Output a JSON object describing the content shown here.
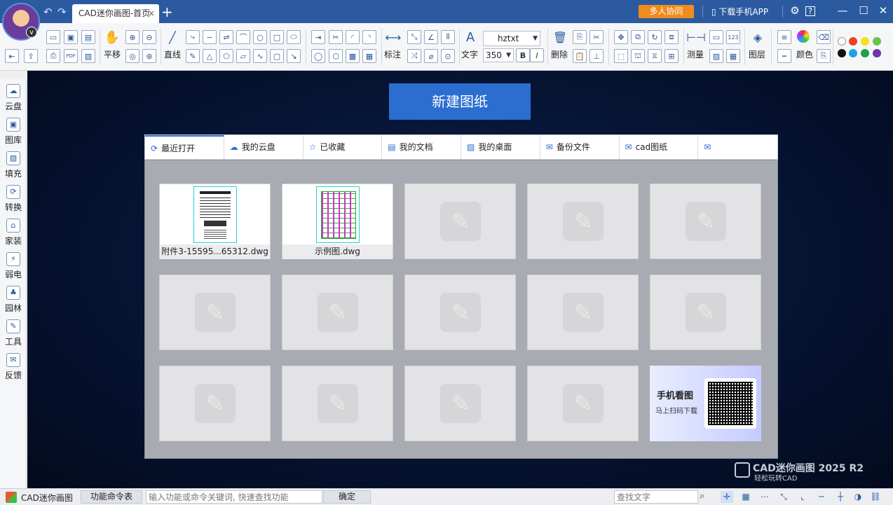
{
  "app": {
    "tab_title": "CAD迷你画图-首页",
    "tab_close": "×",
    "tab_add": "+",
    "collab": "多人协同",
    "download_app": "下载手机APP",
    "win_settings": "⚙",
    "win_help": "?",
    "win_min": "—",
    "win_max": "☐",
    "win_close": "✕",
    "back": "↶",
    "forward": "↷"
  },
  "ribbon": {
    "pan": "平移",
    "line": "直线",
    "annotate": "标注",
    "text": "文字",
    "font_name": "hztxt",
    "font_size": "350",
    "bold": "B",
    "italic": "I",
    "delete": "删除",
    "measure": "测量",
    "layer": "图层",
    "color": "颜色"
  },
  "sidebar": {
    "items": [
      {
        "label": "云盘",
        "icon": "☁"
      },
      {
        "label": "图库",
        "icon": "▣"
      },
      {
        "label": "填充",
        "icon": "▨"
      },
      {
        "label": "转换",
        "icon": "⟳"
      },
      {
        "label": "家装",
        "icon": "⌂"
      },
      {
        "label": "弱电",
        "icon": "⚡"
      },
      {
        "label": "园林",
        "icon": "♣"
      },
      {
        "label": "工具",
        "icon": "✎"
      },
      {
        "label": "反馈",
        "icon": "✉"
      }
    ]
  },
  "main": {
    "new_drawing": "新建图纸",
    "tabs": [
      {
        "label": "最近打开",
        "icon": "⟳"
      },
      {
        "label": "我的云盘",
        "icon": "☁"
      },
      {
        "label": "已收藏",
        "icon": "☆"
      },
      {
        "label": "我的文档",
        "icon": "▤"
      },
      {
        "label": "我的桌面",
        "icon": "▧"
      },
      {
        "label": "备份文件",
        "icon": "✉"
      },
      {
        "label": "cad图纸",
        "icon": "✉"
      },
      {
        "label": "",
        "icon": "✉"
      }
    ],
    "files": [
      {
        "name": "附件3-15595...65312.dwg"
      },
      {
        "name": "示例图.dwg"
      }
    ],
    "promo_title": "手机看图",
    "promo_sub": "马上扫码下载",
    "brand_name": "CAD迷你画图 2025 R2",
    "brand_slogan": "轻松玩转CAD"
  },
  "status": {
    "app_name": "CAD迷你画图",
    "cmd_table": "功能命令表",
    "cmd_placeholder": "输入功能或命令关键词, 快速查找功能",
    "ok": "确定",
    "search_placeholder": "查找文字"
  },
  "colors": {
    "title_bar": "#2b5aa0",
    "accent": "#2c6ed0",
    "collab_orange": "#f08c1b",
    "swatches": [
      "#ffffff",
      "#e8441e",
      "#f4e21b",
      "#6cc24a",
      "#111111",
      "#1aa3e8",
      "#1ea14a",
      "#6b36a8"
    ]
  }
}
